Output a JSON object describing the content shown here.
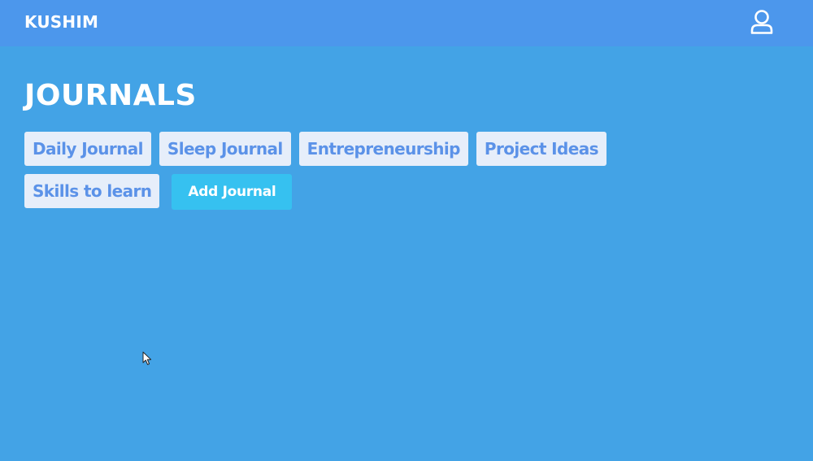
{
  "app": {
    "brand": "KUSHIM"
  },
  "header": {
    "user_icon": "user-icon"
  },
  "page": {
    "title": "JOURNALS"
  },
  "journals": [
    {
      "label": "Daily Journal"
    },
    {
      "label": "Sleep Journal"
    },
    {
      "label": "Entrepreneurship"
    },
    {
      "label": "Project Ideas"
    },
    {
      "label": "Skills to learn"
    }
  ],
  "actions": {
    "add_journal_label": "Add Journal"
  },
  "colors": {
    "background": "#43a3e6",
    "header": "#4c97ec",
    "chip_background": "#e6eefa",
    "chip_text": "#5b92e8",
    "add_button": "#36c1f0",
    "text_light": "#ffffff"
  }
}
